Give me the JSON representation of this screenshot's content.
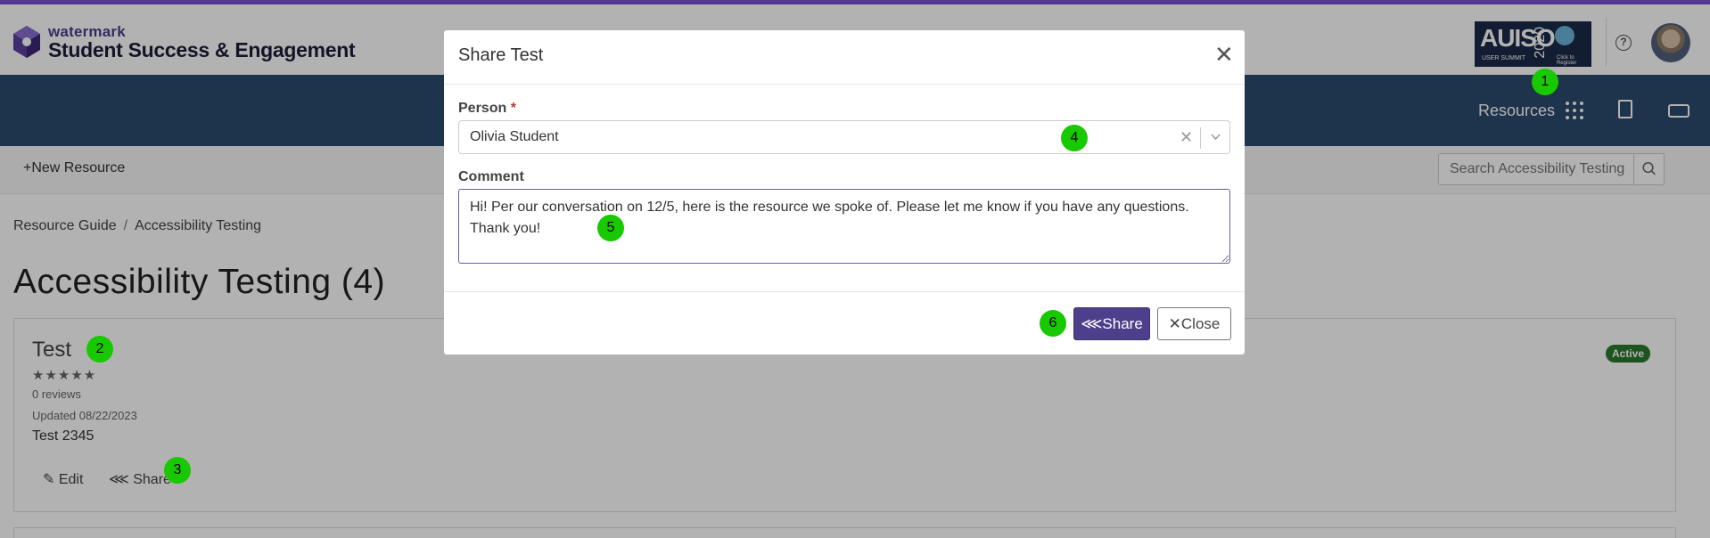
{
  "header": {
    "brand_small": "watermark",
    "brand_big": "Student Success & Engagement",
    "banner_title": "AUISO",
    "banner_sub": "USER SUMMIT",
    "banner_year": "2020",
    "banner_cta": "Click to Register",
    "help_icon": "question-circle-icon",
    "avatar_icon": "user-avatar"
  },
  "navbar": {
    "resources_label": "Resources",
    "apps_icon": "grid-dots-icon",
    "report_icon": "document-chart-icon",
    "inbox_icon": "inbox-icon",
    "background": "#2b4a6e"
  },
  "subbar": {
    "new_resource_label": "New Resource",
    "search_placeholder": "Search Accessibility Testing"
  },
  "breadcrumb": {
    "items": [
      "Resource Guide",
      "Accessibility Testing"
    ],
    "separator": "/"
  },
  "page": {
    "title": "Accessibility Testing (4)"
  },
  "card": {
    "title": "Test",
    "stars": "★★★★★",
    "reviews": "0 reviews",
    "updated": "Updated 08/22/2023",
    "description": "Test 2345",
    "edit_label": "Edit",
    "share_label": "Share",
    "status": "Active",
    "status_color": "#2c7a2c"
  },
  "modal": {
    "title": "Share Test",
    "person_label": "Person",
    "required_mark": "*",
    "person_value": "Olivia Student",
    "comment_label": "Comment",
    "comment_value": "Hi! Per our conversation on 12/5, here is the resource we spoke of. Please let me know if you have any questions. Thank you!",
    "share_button": "Share",
    "close_button": "Close",
    "accent": "#4e3f8c"
  },
  "markers": [
    "1",
    "2",
    "3",
    "4",
    "5",
    "6"
  ]
}
